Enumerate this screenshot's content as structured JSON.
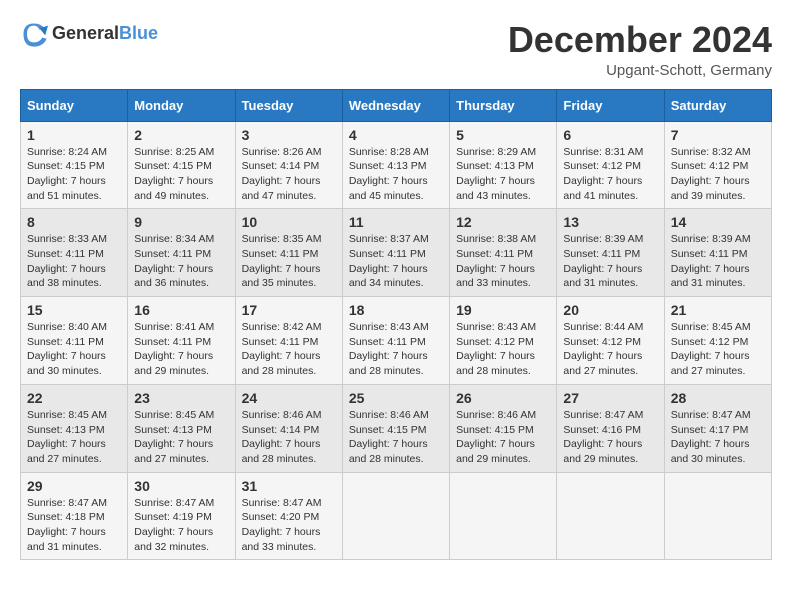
{
  "header": {
    "logo_general": "General",
    "logo_blue": "Blue",
    "title": "December 2024",
    "subtitle": "Upgant-Schott, Germany"
  },
  "days_of_week": [
    "Sunday",
    "Monday",
    "Tuesday",
    "Wednesday",
    "Thursday",
    "Friday",
    "Saturday"
  ],
  "weeks": [
    [
      {
        "day": "1",
        "sunrise": "8:24 AM",
        "sunset": "4:15 PM",
        "daylight": "7 hours and 51 minutes."
      },
      {
        "day": "2",
        "sunrise": "8:25 AM",
        "sunset": "4:15 PM",
        "daylight": "7 hours and 49 minutes."
      },
      {
        "day": "3",
        "sunrise": "8:26 AM",
        "sunset": "4:14 PM",
        "daylight": "7 hours and 47 minutes."
      },
      {
        "day": "4",
        "sunrise": "8:28 AM",
        "sunset": "4:13 PM",
        "daylight": "7 hours and 45 minutes."
      },
      {
        "day": "5",
        "sunrise": "8:29 AM",
        "sunset": "4:13 PM",
        "daylight": "7 hours and 43 minutes."
      },
      {
        "day": "6",
        "sunrise": "8:31 AM",
        "sunset": "4:12 PM",
        "daylight": "7 hours and 41 minutes."
      },
      {
        "day": "7",
        "sunrise": "8:32 AM",
        "sunset": "4:12 PM",
        "daylight": "7 hours and 39 minutes."
      }
    ],
    [
      {
        "day": "8",
        "sunrise": "8:33 AM",
        "sunset": "4:11 PM",
        "daylight": "7 hours and 38 minutes."
      },
      {
        "day": "9",
        "sunrise": "8:34 AM",
        "sunset": "4:11 PM",
        "daylight": "7 hours and 36 minutes."
      },
      {
        "day": "10",
        "sunrise": "8:35 AM",
        "sunset": "4:11 PM",
        "daylight": "7 hours and 35 minutes."
      },
      {
        "day": "11",
        "sunrise": "8:37 AM",
        "sunset": "4:11 PM",
        "daylight": "7 hours and 34 minutes."
      },
      {
        "day": "12",
        "sunrise": "8:38 AM",
        "sunset": "4:11 PM",
        "daylight": "7 hours and 33 minutes."
      },
      {
        "day": "13",
        "sunrise": "8:39 AM",
        "sunset": "4:11 PM",
        "daylight": "7 hours and 31 minutes."
      },
      {
        "day": "14",
        "sunrise": "8:39 AM",
        "sunset": "4:11 PM",
        "daylight": "7 hours and 31 minutes."
      }
    ],
    [
      {
        "day": "15",
        "sunrise": "8:40 AM",
        "sunset": "4:11 PM",
        "daylight": "7 hours and 30 minutes."
      },
      {
        "day": "16",
        "sunrise": "8:41 AM",
        "sunset": "4:11 PM",
        "daylight": "7 hours and 29 minutes."
      },
      {
        "day": "17",
        "sunrise": "8:42 AM",
        "sunset": "4:11 PM",
        "daylight": "7 hours and 28 minutes."
      },
      {
        "day": "18",
        "sunrise": "8:43 AM",
        "sunset": "4:11 PM",
        "daylight": "7 hours and 28 minutes."
      },
      {
        "day": "19",
        "sunrise": "8:43 AM",
        "sunset": "4:12 PM",
        "daylight": "7 hours and 28 minutes."
      },
      {
        "day": "20",
        "sunrise": "8:44 AM",
        "sunset": "4:12 PM",
        "daylight": "7 hours and 27 minutes."
      },
      {
        "day": "21",
        "sunrise": "8:45 AM",
        "sunset": "4:12 PM",
        "daylight": "7 hours and 27 minutes."
      }
    ],
    [
      {
        "day": "22",
        "sunrise": "8:45 AM",
        "sunset": "4:13 PM",
        "daylight": "7 hours and 27 minutes."
      },
      {
        "day": "23",
        "sunrise": "8:45 AM",
        "sunset": "4:13 PM",
        "daylight": "7 hours and 27 minutes."
      },
      {
        "day": "24",
        "sunrise": "8:46 AM",
        "sunset": "4:14 PM",
        "daylight": "7 hours and 28 minutes."
      },
      {
        "day": "25",
        "sunrise": "8:46 AM",
        "sunset": "4:15 PM",
        "daylight": "7 hours and 28 minutes."
      },
      {
        "day": "26",
        "sunrise": "8:46 AM",
        "sunset": "4:15 PM",
        "daylight": "7 hours and 29 minutes."
      },
      {
        "day": "27",
        "sunrise": "8:47 AM",
        "sunset": "4:16 PM",
        "daylight": "7 hours and 29 minutes."
      },
      {
        "day": "28",
        "sunrise": "8:47 AM",
        "sunset": "4:17 PM",
        "daylight": "7 hours and 30 minutes."
      }
    ],
    [
      {
        "day": "29",
        "sunrise": "8:47 AM",
        "sunset": "4:18 PM",
        "daylight": "7 hours and 31 minutes."
      },
      {
        "day": "30",
        "sunrise": "8:47 AM",
        "sunset": "4:19 PM",
        "daylight": "7 hours and 32 minutes."
      },
      {
        "day": "31",
        "sunrise": "8:47 AM",
        "sunset": "4:20 PM",
        "daylight": "7 hours and 33 minutes."
      },
      null,
      null,
      null,
      null
    ]
  ],
  "labels": {
    "sunrise": "Sunrise:",
    "sunset": "Sunset:",
    "daylight": "Daylight hours"
  }
}
